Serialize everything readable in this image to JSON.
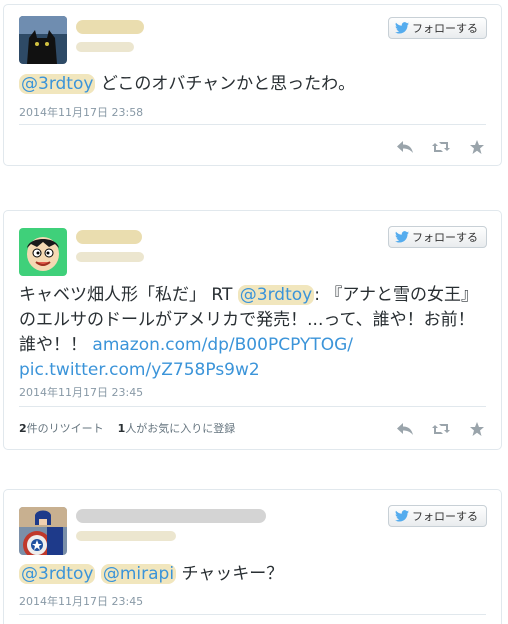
{
  "follow_label": "フォローする",
  "tweets": [
    {
      "mention": "@3rdtoy",
      "text": " どこのオバチャンかと思ったわ。",
      "timestamp": "2014年11月17日 23:58"
    },
    {
      "text_prefix": "キャベツ畑人形「私だ」 RT ",
      "mention": "@3rdtoy",
      "text_main": ": 『アナと雪の女王』のエルサのドールがアメリカで発売！...って、誰や！お前！誰や！！ ",
      "link1": "amazon.com/dp/B00PCPYTOG/",
      "link2": "pic.twitter.com/yZ758Ps9w2",
      "timestamp": "2014年11月17日 23:45",
      "retweet_count": "2",
      "retweet_label": "件のリツイート",
      "favorite_count": "1",
      "favorite_label": "人がお気に入りに登録"
    },
    {
      "mention1": "@3rdtoy",
      "mention2": "@mirapi",
      "text": " チャッキー？",
      "timestamp": "2014年11月17日 23:45"
    }
  ],
  "icons": {
    "follow": "twitter-bird-icon",
    "reply": "reply-icon",
    "retweet": "retweet-icon",
    "favorite": "star-icon"
  },
  "colors": {
    "link": "#3b94d9",
    "muted": "#8899a6",
    "text": "#292f33",
    "border": "#e1e8ed"
  }
}
